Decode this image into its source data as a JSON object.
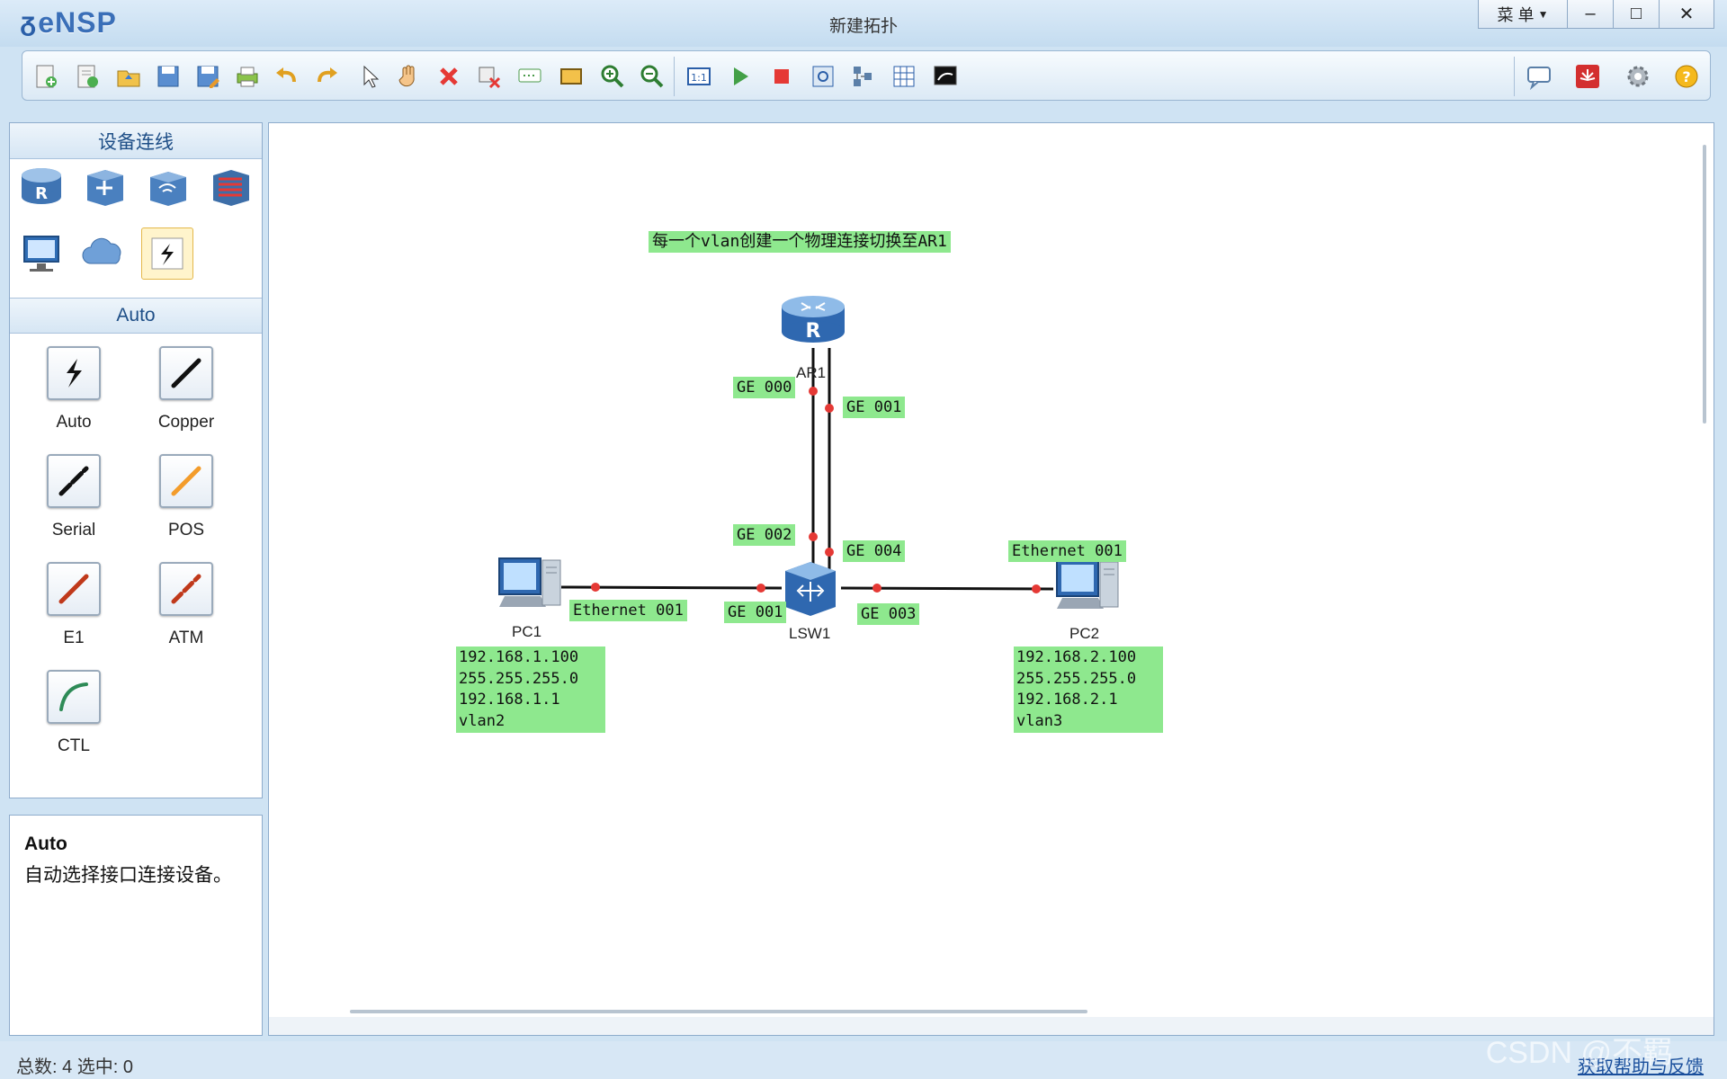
{
  "app": {
    "name": "eNSP",
    "window_title": "新建拓扑"
  },
  "window_controls": {
    "menu": "菜 单",
    "minimize": "–",
    "maximize": "□",
    "close": "✕"
  },
  "toolbar": {
    "icons": [
      "new-topology-icon",
      "new-lab-icon",
      "open-icon",
      "save-icon",
      "save-as-icon",
      "print-icon",
      "undo-icon",
      "redo-icon",
      "select-icon",
      "pan-icon",
      "delete-icon",
      "delete-link-icon",
      "add-text-icon",
      "add-rectangle-icon",
      "zoom-in-icon",
      "zoom-out-icon",
      "fit-icon",
      "start-icon",
      "stop-icon",
      "capture-icon",
      "topology-icon",
      "grid-icon",
      "console-icon"
    ],
    "right_icons": [
      "chat-icon",
      "huawei-icon",
      "settings-icon",
      "help-icon"
    ]
  },
  "left_panel": {
    "device_header": "设备连线",
    "cable_header": "Auto",
    "cables": [
      "Auto",
      "Copper",
      "Serial",
      "POS",
      "E1",
      "ATM",
      "CTL"
    ],
    "description_title": "Auto",
    "description_text": "自动选择接口连接设备。"
  },
  "canvas": {
    "note": "每一个vlan创建一个物理连接切换至AR1",
    "devices": {
      "router": "AR1",
      "switch": "LSW1",
      "pc1": "PC1",
      "pc2": "PC2"
    },
    "port_labels": {
      "ar1_ge000": "GE 000",
      "ar1_ge001": "GE 001",
      "lsw_ge002": "GE 002",
      "lsw_ge004": "GE 004",
      "lsw_ge001": "GE 001",
      "lsw_ge003": "GE 003",
      "pc1_eth": "Ethernet 001",
      "pc2_eth": "Ethernet 001"
    },
    "pc1_info": [
      "192.168.1.100",
      "255.255.255.0",
      "192.168.1.1",
      "vlan2"
    ],
    "pc2_info": [
      "192.168.2.100",
      "255.255.255.0",
      "192.168.2.1",
      "vlan3"
    ]
  },
  "status": {
    "text": "总数: 4 选中: 0",
    "help": "获取帮助与反馈"
  },
  "watermark": "CSDN @不羁",
  "colors": {
    "label_bg": "#8ee88e",
    "link_dot": "#e53935",
    "accent": "#3a6fb8"
  }
}
